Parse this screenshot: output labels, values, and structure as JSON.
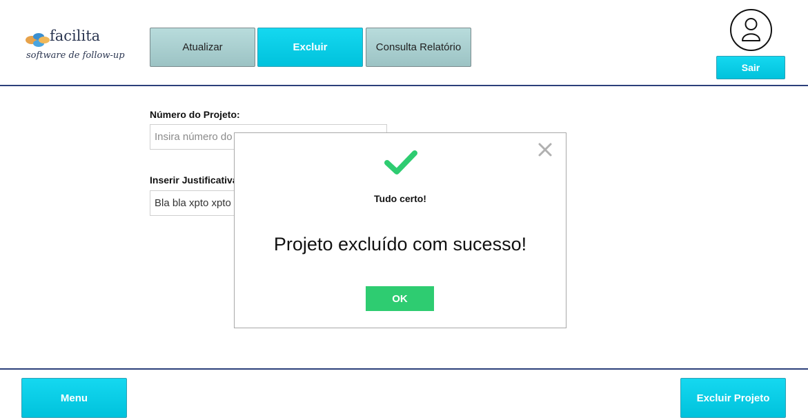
{
  "brand": {
    "name": "facilita",
    "tagline": "software de follow-up"
  },
  "tabs": [
    {
      "label": "Atualizar"
    },
    {
      "label": "Excluir"
    },
    {
      "label": "Consulta Relatório"
    }
  ],
  "user": {
    "avatar_icon": "user-avatar-icon",
    "logout_label": "Sair"
  },
  "form": {
    "project_number_label": "Número do Projeto:",
    "project_number_placeholder": "Insira número do projeto",
    "justification_label": "Inserir Justificativa:",
    "justification_value": "Bla bla xpto xpto"
  },
  "modal": {
    "icon": "check-icon",
    "title": "Tudo certo!",
    "message": "Projeto excluído com sucesso!",
    "ok_label": "OK"
  },
  "footer": {
    "menu_label": "Menu",
    "delete_project_label": "Excluir Projeto"
  },
  "colors": {
    "accent": "#00c8e0",
    "success": "#2ecc71",
    "rule": "#2b3f7a"
  }
}
